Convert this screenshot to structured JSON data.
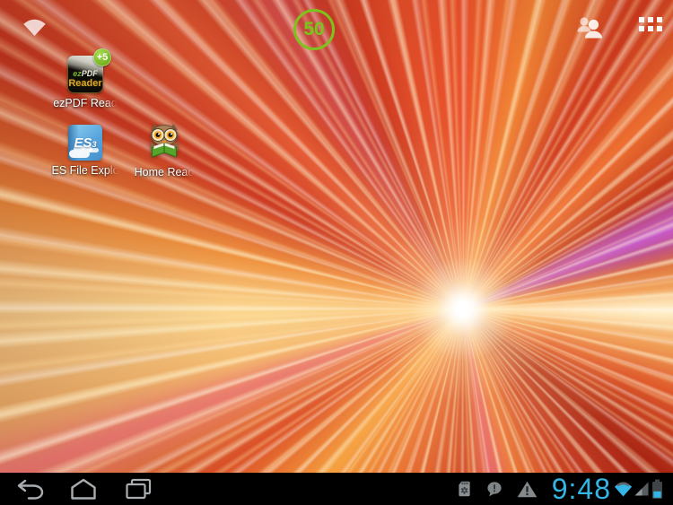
{
  "top_bar": {
    "wifi_icon": "wifi",
    "people_icon": "people-group",
    "all_apps_icon": "all-apps-grid",
    "battery_widget": {
      "value": "50",
      "ring_color": "#7dc31d"
    }
  },
  "home_apps": [
    {
      "label": "ezPDF Read",
      "badge": "+5",
      "icon": {
        "line1_accent": "ez",
        "line1_rest": "PDF",
        "line2": "Reader"
      }
    },
    {
      "label": "ES File Explo",
      "icon": {
        "brand": "ES",
        "brand_sub": "3"
      }
    },
    {
      "label": "Home Read",
      "icon": {
        "glyph": "owl-reading-book"
      }
    }
  ],
  "nav_bar": {
    "back_icon": "back",
    "home_icon": "home",
    "recents_icon": "recent-apps"
  },
  "status_tray": {
    "sd_card_icon": "sd-card-settings",
    "message_alert_icon": "message-alert",
    "warning_icon": "warning-triangle",
    "clock": "9:48",
    "wifi_icon": "wifi-signal",
    "cell_signal_icon": "cell-signal",
    "battery_icon": "battery-level",
    "accent_color": "#33b5e5"
  },
  "wallpaper": {
    "style": "radial-light-burst",
    "palette": [
      "#ffffff",
      "#ffe3ae",
      "#f5a03e",
      "#e4662c",
      "#c63c20",
      "#a82413",
      "#c860ee"
    ]
  }
}
